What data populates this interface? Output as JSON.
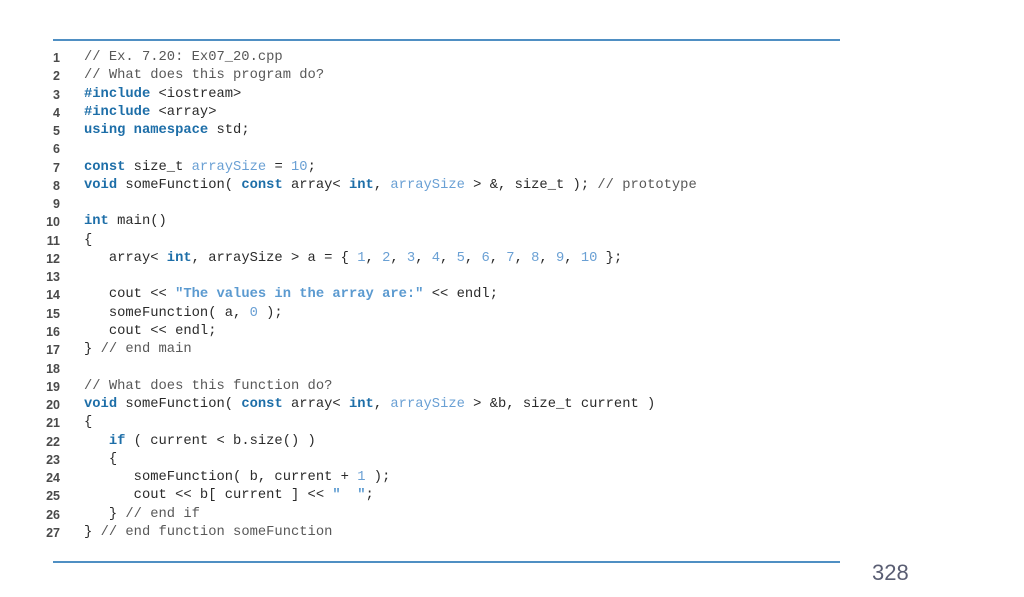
{
  "page_number": "328",
  "colors": {
    "rule": "#4f8fc3",
    "keyword": "#1d6ea8",
    "identifier_highlight": "#6aa0d4",
    "comment": "#585858",
    "text": "#2a2a2a"
  },
  "code_listing": {
    "title_comment": "// Ex. 7.20: Ex07_20.cpp",
    "lines": [
      {
        "n": "1",
        "tokens": [
          [
            "cm",
            "// Ex. 7.20: Ex07_20.cpp"
          ]
        ]
      },
      {
        "n": "2",
        "tokens": [
          [
            "cm",
            "// What does this program do?"
          ]
        ]
      },
      {
        "n": "3",
        "tokens": [
          [
            "kw",
            "#include"
          ],
          [
            "tx",
            " <iostream>"
          ]
        ]
      },
      {
        "n": "4",
        "tokens": [
          [
            "kw",
            "#include"
          ],
          [
            "tx",
            " <array>"
          ]
        ]
      },
      {
        "n": "5",
        "tokens": [
          [
            "kw",
            "using namespace"
          ],
          [
            "tx",
            " std;"
          ]
        ]
      },
      {
        "n": "6",
        "tokens": []
      },
      {
        "n": "7",
        "tokens": [
          [
            "kw",
            "const"
          ],
          [
            "tx",
            " size_t "
          ],
          [
            "id",
            "arraySize"
          ],
          [
            "tx",
            " = "
          ],
          [
            "lit",
            "10"
          ],
          [
            "tx",
            ";"
          ]
        ]
      },
      {
        "n": "8",
        "tokens": [
          [
            "kw",
            "void"
          ],
          [
            "tx",
            " someFunction( "
          ],
          [
            "kw",
            "const"
          ],
          [
            "tx",
            " array< "
          ],
          [
            "kw",
            "int"
          ],
          [
            "tx",
            ", "
          ],
          [
            "id",
            "arraySize"
          ],
          [
            "tx",
            " > &, size_t ); "
          ],
          [
            "cm",
            "// prototype"
          ]
        ]
      },
      {
        "n": "9",
        "tokens": []
      },
      {
        "n": "10",
        "tokens": [
          [
            "kw",
            "int"
          ],
          [
            "tx",
            " main()"
          ]
        ]
      },
      {
        "n": "11",
        "tokens": [
          [
            "tx",
            "{"
          ]
        ]
      },
      {
        "n": "12",
        "tokens": [
          [
            "tx",
            "   array< "
          ],
          [
            "kw",
            "int"
          ],
          [
            "tx",
            ", arraySize > a = { "
          ],
          [
            "lit",
            "1"
          ],
          [
            "tx",
            ", "
          ],
          [
            "lit",
            "2"
          ],
          [
            "tx",
            ", "
          ],
          [
            "lit",
            "3"
          ],
          [
            "tx",
            ", "
          ],
          [
            "lit",
            "4"
          ],
          [
            "tx",
            ", "
          ],
          [
            "lit",
            "5"
          ],
          [
            "tx",
            ", "
          ],
          [
            "lit",
            "6"
          ],
          [
            "tx",
            ", "
          ],
          [
            "lit",
            "7"
          ],
          [
            "tx",
            ", "
          ],
          [
            "lit",
            "8"
          ],
          [
            "tx",
            ", "
          ],
          [
            "lit",
            "9"
          ],
          [
            "tx",
            ", "
          ],
          [
            "lit",
            "10"
          ],
          [
            "tx",
            " };"
          ]
        ]
      },
      {
        "n": "13",
        "tokens": []
      },
      {
        "n": "14",
        "tokens": [
          [
            "tx",
            "   cout << "
          ],
          [
            "str",
            "\"The values in the array are:\""
          ],
          [
            "tx",
            " << endl;"
          ]
        ]
      },
      {
        "n": "15",
        "tokens": [
          [
            "tx",
            "   someFunction( a, "
          ],
          [
            "lit",
            "0"
          ],
          [
            "tx",
            " );"
          ]
        ]
      },
      {
        "n": "16",
        "tokens": [
          [
            "tx",
            "   cout << endl;"
          ]
        ]
      },
      {
        "n": "17",
        "tokens": [
          [
            "tx",
            "} "
          ],
          [
            "cm",
            "// end main"
          ]
        ]
      },
      {
        "n": "18",
        "tokens": []
      },
      {
        "n": "19",
        "tokens": [
          [
            "cm",
            "// What does this function do?"
          ]
        ]
      },
      {
        "n": "20",
        "tokens": [
          [
            "kw",
            "void"
          ],
          [
            "tx",
            " someFunction( "
          ],
          [
            "kw",
            "const"
          ],
          [
            "tx",
            " array< "
          ],
          [
            "kw",
            "int"
          ],
          [
            "tx",
            ", "
          ],
          [
            "id",
            "arraySize"
          ],
          [
            "tx",
            " > &b, size_t current )"
          ]
        ]
      },
      {
        "n": "21",
        "tokens": [
          [
            "tx",
            "{"
          ]
        ]
      },
      {
        "n": "22",
        "tokens": [
          [
            "tx",
            "   "
          ],
          [
            "kw",
            "if"
          ],
          [
            "tx",
            " ( current < b.size() )"
          ]
        ]
      },
      {
        "n": "23",
        "tokens": [
          [
            "tx",
            "   {"
          ]
        ]
      },
      {
        "n": "24",
        "tokens": [
          [
            "tx",
            "      someFunction( b, current + "
          ],
          [
            "lit",
            "1"
          ],
          [
            "tx",
            " );"
          ]
        ]
      },
      {
        "n": "25",
        "tokens": [
          [
            "tx",
            "      cout << b[ current ] << "
          ],
          [
            "str",
            "\"  \""
          ],
          [
            "tx",
            ";"
          ]
        ]
      },
      {
        "n": "26",
        "tokens": [
          [
            "tx",
            "   } "
          ],
          [
            "cm",
            "// end if"
          ]
        ]
      },
      {
        "n": "27",
        "tokens": [
          [
            "tx",
            "} "
          ],
          [
            "cm",
            "// end function someFunction"
          ]
        ]
      }
    ]
  }
}
